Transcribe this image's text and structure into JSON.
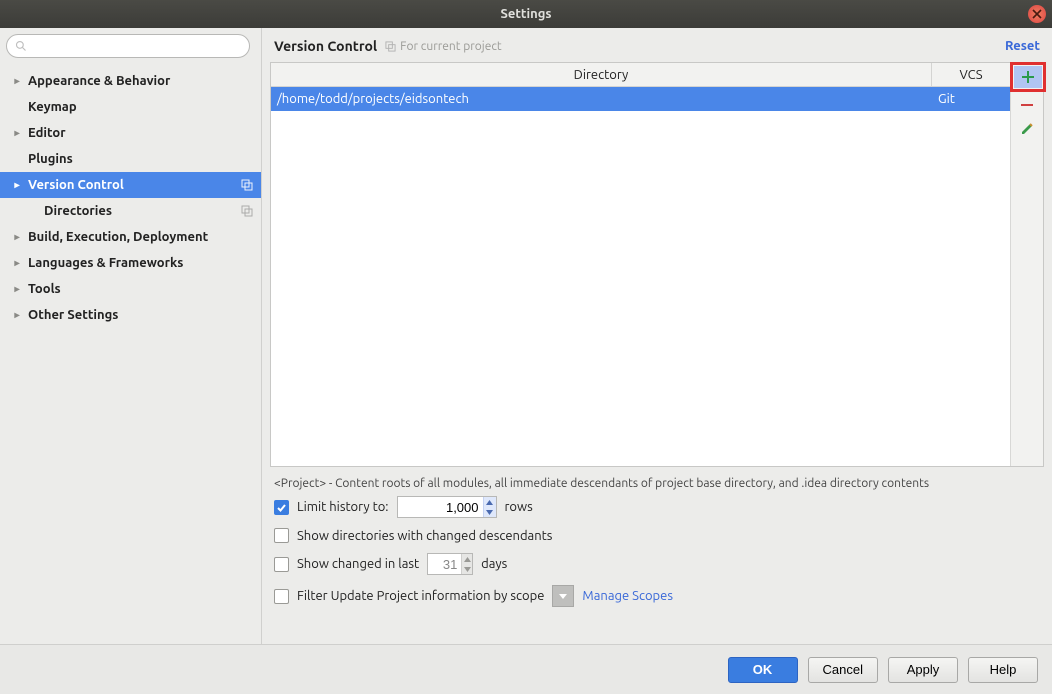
{
  "window": {
    "title": "Settings"
  },
  "sidebar": {
    "search_placeholder": "",
    "items": [
      {
        "label": "Appearance & Behavior",
        "expandable": true,
        "depth": 0
      },
      {
        "label": "Keymap",
        "expandable": false,
        "depth": 0
      },
      {
        "label": "Editor",
        "expandable": true,
        "depth": 0
      },
      {
        "label": "Plugins",
        "expandable": false,
        "depth": 0
      },
      {
        "label": "Version Control",
        "expandable": true,
        "depth": 0,
        "selected": true,
        "project_icon": true
      },
      {
        "label": "Directories",
        "expandable": false,
        "depth": 1,
        "project_icon": true
      },
      {
        "label": "Build, Execution, Deployment",
        "expandable": true,
        "depth": 0
      },
      {
        "label": "Languages & Frameworks",
        "expandable": true,
        "depth": 0
      },
      {
        "label": "Tools",
        "expandable": true,
        "depth": 0
      },
      {
        "label": "Other Settings",
        "expandable": true,
        "depth": 0
      }
    ]
  },
  "header": {
    "title": "Version Control",
    "scope": "For current project",
    "reset": "Reset"
  },
  "table": {
    "col_directory": "Directory",
    "col_vcs": "VCS",
    "rows": [
      {
        "directory": "/home/todd/projects/eidsontech",
        "vcs": "Git"
      }
    ]
  },
  "note": "<Project> - Content roots of all modules, all immediate descendants of project base directory, and .idea directory contents",
  "options": {
    "limit_history_label": "Limit history to:",
    "limit_history_value": "1,000",
    "limit_history_unit": "rows",
    "show_changed_desc": "Show directories with changed descendants",
    "show_changed_last_pre": "Show changed in last",
    "show_changed_last_val": "31",
    "show_changed_last_unit": "days",
    "filter_scope": "Filter Update Project information by scope",
    "manage_scopes": "Manage Scopes"
  },
  "footer": {
    "ok": "OK",
    "cancel": "Cancel",
    "apply": "Apply",
    "help": "Help"
  }
}
